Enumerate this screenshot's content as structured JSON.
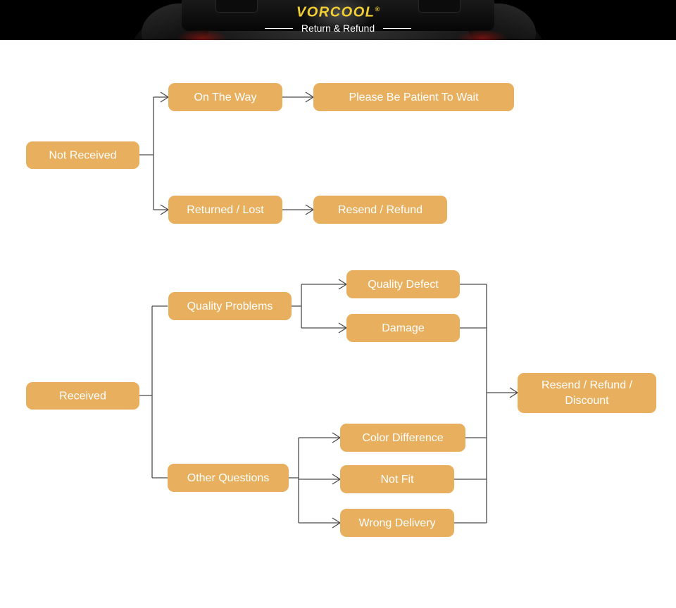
{
  "banner": {
    "logo_text": "VORCOOL",
    "logo_registered": "®",
    "subtitle": "Return & Refund",
    "background_color": "#000000",
    "logo_color": "#f2d033",
    "subtitle_color": "#ffffff"
  },
  "theme": {
    "node_fill": "#e8b05e",
    "node_text_color": "#ffffff",
    "connector_color": "#4a4a4a",
    "page_background": "#ffffff"
  },
  "flowchart": {
    "title": "Return & Refund",
    "nodes": {
      "not_received": "Not Received",
      "on_the_way": "On The Way",
      "please_wait": "Please Be Patient To Wait",
      "returned_lost": "Returned / Lost",
      "resend_refund": "Resend / Refund",
      "received": "Received",
      "quality_problems": "Quality Problems",
      "other_questions": "Other Questions",
      "quality_defect": "Quality Defect",
      "damage": "Damage",
      "color_difference": "Color Difference",
      "not_fit": "Not Fit",
      "wrong_delivery": "Wrong Delivery",
      "resend_refund_discount_line1": "Resend / Refund /",
      "resend_refund_discount_line2": "Discount"
    }
  }
}
